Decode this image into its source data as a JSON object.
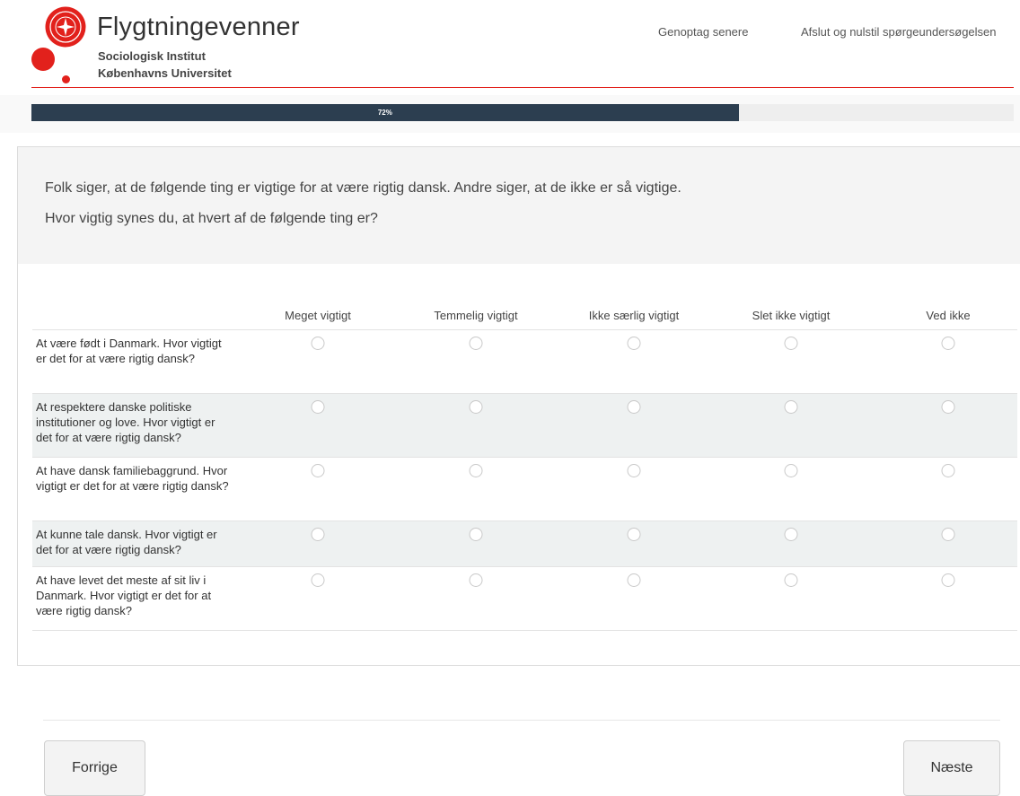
{
  "header": {
    "brand_title": "Flygtningevenner",
    "subtitle_line1": "Sociologisk Institut",
    "subtitle_line2": "Københavns Universitet",
    "link_resume": "Genoptag senere",
    "link_reset": "Afslut og nulstil spørgeundersøgelsen"
  },
  "progress": {
    "value": 0.72,
    "label": "72%"
  },
  "question": {
    "line1": "Folk siger, at de følgende ting er vigtige for at være rigtig dansk. Andre siger, at de ikke er så vigtige.",
    "line2": "Hvor vigtig synes du, at hvert af de følgende ting er?"
  },
  "matrix": {
    "columns": [
      "Meget vigtigt",
      "Temmelig vigtigt",
      "Ikke særlig vigtigt",
      "Slet ikke vigtigt",
      "Ved ikke"
    ],
    "rows": [
      "At være født i Danmark. Hvor vigtigt er det for at være rigtig dansk?",
      "At respektere danske politiske institutioner og love. Hvor vigtigt er det for at være rigtig dansk?",
      "At have dansk familiebaggrund. Hvor vigtigt er det for at være rigtig dansk?",
      "At kunne tale dansk. Hvor vigtigt er det for at være rigtig dansk?",
      "At have levet det meste af sit liv i Danmark. Hvor vigtigt er det for at være rigtig dansk?"
    ]
  },
  "nav": {
    "prev_label": "Forrige",
    "next_label": "Næste"
  },
  "colors": {
    "accent": "#e2211c",
    "progress": "#2c3e50"
  },
  "icons": {
    "logo": "university-seal-icon",
    "radio": "radio-empty-icon"
  }
}
